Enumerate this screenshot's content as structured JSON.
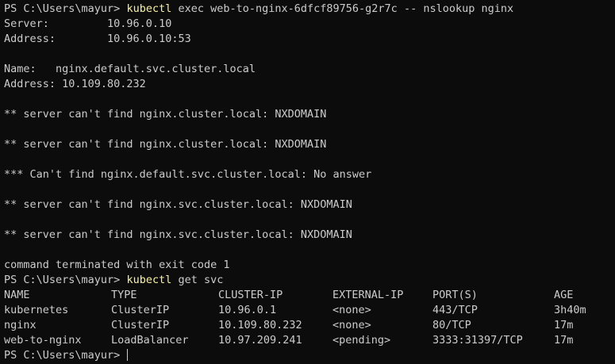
{
  "prompt_text": "PS C:\\Users\\mayur> ",
  "commands": {
    "first_tool": "kubectl",
    "first_args": " exec web-to-nginx-6dfcf89756-g2r7c -- nslookup nginx",
    "second_tool": "kubectl",
    "second_args": " get svc"
  },
  "output_lines": [
    "Server:         10.96.0.10",
    "Address:        10.96.0.10:53",
    "",
    "Name:   nginx.default.svc.cluster.local",
    "Address: 10.109.80.232",
    "",
    "** server can't find nginx.cluster.local: NXDOMAIN",
    "",
    "** server can't find nginx.cluster.local: NXDOMAIN",
    "",
    "*** Can't find nginx.default.svc.cluster.local: No answer",
    "",
    "** server can't find nginx.svc.cluster.local: NXDOMAIN",
    "",
    "** server can't find nginx.svc.cluster.local: NXDOMAIN",
    "",
    "command terminated with exit code 1"
  ],
  "svc_table": {
    "headers": [
      "NAME",
      "TYPE",
      "CLUSTER-IP",
      "EXTERNAL-IP",
      "PORT(S)",
      "AGE"
    ],
    "rows": [
      [
        "kubernetes",
        "ClusterIP",
        "10.96.0.1",
        "<none>",
        "443/TCP",
        "3h40m"
      ],
      [
        "nginx",
        "ClusterIP",
        "10.109.80.232",
        "<none>",
        "80/TCP",
        "17m"
      ],
      [
        "web-to-nginx",
        "LoadBalancer",
        "10.97.209.241",
        "<pending>",
        "3333:31397/TCP",
        "17m"
      ]
    ]
  },
  "colors": {
    "background": "#0c0c0c",
    "text": "#cccccc",
    "command": "#f9f1a5"
  }
}
